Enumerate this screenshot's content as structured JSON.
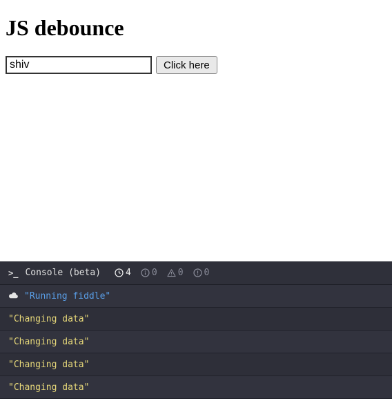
{
  "page": {
    "title": "JS debounce",
    "input_value": "shiv",
    "button_label": "Click here"
  },
  "console": {
    "title": "Console (beta)",
    "counts": {
      "log": "4",
      "info": "0",
      "warn": "0",
      "error": "0"
    },
    "logs": [
      {
        "level": "info",
        "text": "\"Running fiddle\"",
        "has_cloud": true
      },
      {
        "level": "plain",
        "text": "\"Changing data\"",
        "has_cloud": false
      },
      {
        "level": "plain",
        "text": "\"Changing data\"",
        "has_cloud": false
      },
      {
        "level": "plain",
        "text": "\"Changing data\"",
        "has_cloud": false
      },
      {
        "level": "plain",
        "text": "\"Changing data\"",
        "has_cloud": false
      }
    ]
  }
}
